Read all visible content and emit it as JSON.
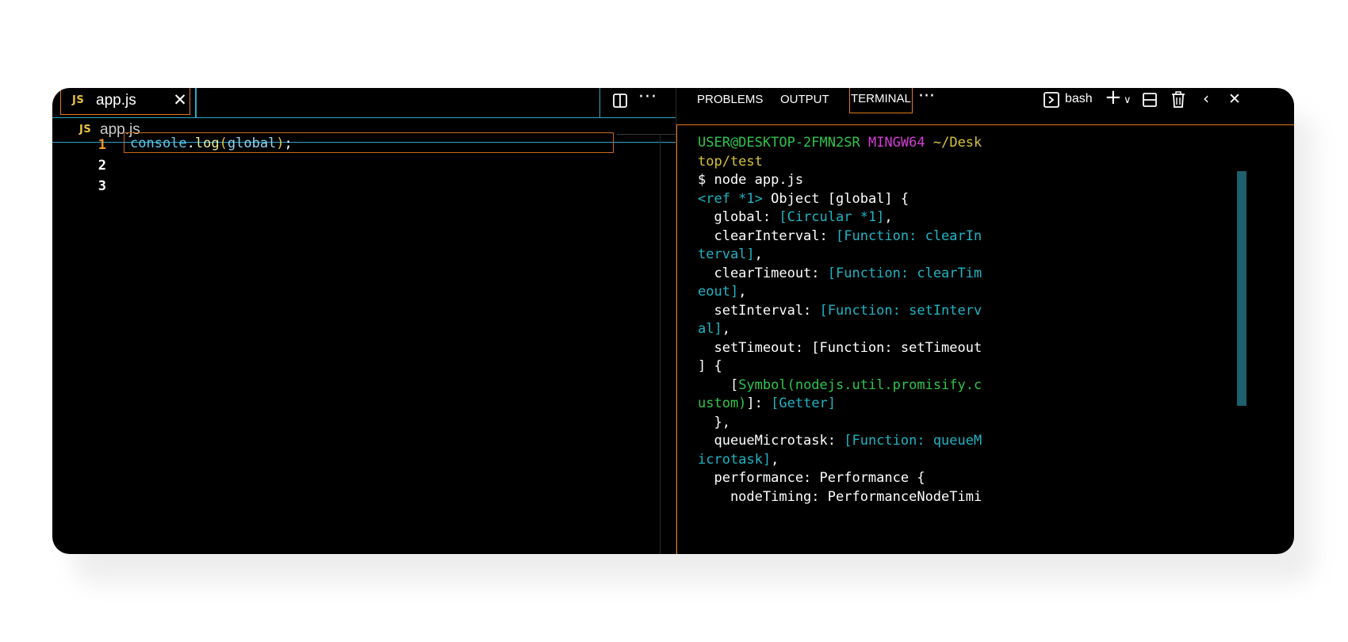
{
  "editor": {
    "tab": {
      "badge": "JS",
      "label": "app.js",
      "close_icon": "close-icon"
    },
    "actions": {
      "split_icon": "split-editor-icon",
      "more_icon": "more-actions-icon",
      "more_label": "···"
    },
    "breadcrumb": {
      "badge": "JS",
      "label": "app.js"
    },
    "line_numbers": [
      "1",
      "2",
      "3"
    ],
    "active_line": "1",
    "code": {
      "object": "console",
      "dot": ".",
      "method": "log",
      "open": "(",
      "arg": "global",
      "close": ")",
      "end": ";"
    }
  },
  "panel": {
    "tabs": [
      {
        "label": "PROBLEMS"
      },
      {
        "label": "OUTPUT"
      },
      {
        "label": "TERMINAL",
        "active": true
      }
    ],
    "more_label": "···",
    "shell_label": "bash",
    "controls": [
      "terminal-icon",
      "plus-icon",
      "chevron-down-icon",
      "split-terminal-icon",
      "trash-icon",
      "chevron-left-icon",
      "close-icon"
    ]
  },
  "terminal": {
    "prompt_user": "USER@DESKTOP-2FMN2SR",
    "prompt_env": "MINGW64",
    "prompt_path_1": "~/Desk",
    "prompt_path_2": "top/test",
    "command": "$ node app.js",
    "l4a": "<ref *1>",
    "l4b": " Object [global] {",
    "l5a": "  global: ",
    "l5b": "[Circular *1]",
    "l5c": ",",
    "l6a": "  clearInterval: ",
    "l6b": "[Function: clearIn",
    "l7a": "terval]",
    "l7b": ",",
    "l8a": "  clearTimeout: ",
    "l8b": "[Function: clearTim",
    "l9a": "eout]",
    "l9b": ",",
    "l10a": "  setInterval: ",
    "l10b": "[Function: setInterv",
    "l11a": "al]",
    "l11b": ",",
    "l12": "  setTimeout: [Function: setTimeout",
    "l13": "] {",
    "l14a": "    [",
    "l14b": "Symbol(nodejs.util.promisify.c",
    "l15a": "ustom)",
    "l15b": "]: ",
    "l15c": "[Getter]",
    "l16": "  },",
    "l17a": "  queueMicrotask: ",
    "l17b": "[Function: queueM",
    "l18a": "icrotask]",
    "l18b": ",",
    "l19": "  performance: Performance {",
    "l20": "    nodeTiming: PerformanceNodeTimi"
  }
}
